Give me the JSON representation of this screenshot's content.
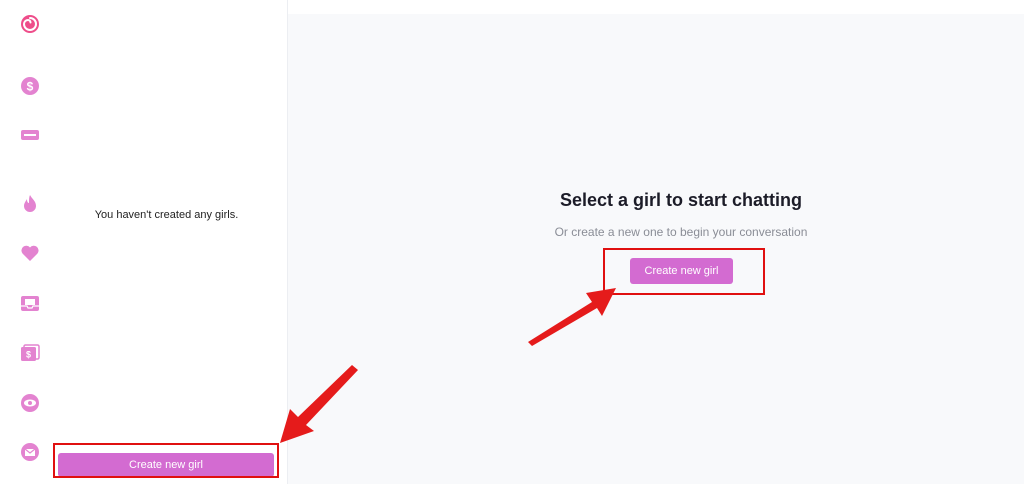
{
  "rail": {
    "icons": [
      {
        "name": "logo-swirl-icon"
      },
      {
        "name": "coin-icon"
      },
      {
        "name": "new-badge-icon"
      },
      {
        "name": "fire-icon"
      },
      {
        "name": "heart-icon"
      },
      {
        "name": "inbox-icon"
      },
      {
        "name": "gallery-icon"
      },
      {
        "name": "eye-icon"
      },
      {
        "name": "mail-icon"
      }
    ],
    "accent": "#e383d0",
    "logo_color": "#ee4d8a"
  },
  "list_panel": {
    "empty_message": "You haven't created any girls.",
    "create_button": "Create new girl"
  },
  "main": {
    "title": "Select a girl to start chatting",
    "subtitle": "Or create a new one to begin your conversation",
    "create_button": "Create new girl"
  },
  "colors": {
    "button_bg": "#d36bd1",
    "highlight": "#e01010"
  }
}
